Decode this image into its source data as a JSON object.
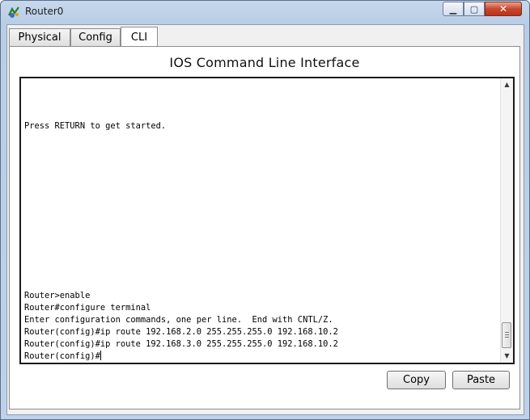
{
  "window": {
    "title": "Router0"
  },
  "tabs": [
    {
      "label": "Physical"
    },
    {
      "label": "Config"
    },
    {
      "label": "CLI"
    }
  ],
  "cli": {
    "heading": "IOS Command Line Interface",
    "lines": [
      "Press RETURN to get started.",
      "Router>enable",
      "Router#configure terminal",
      "Enter configuration commands, one per line.  End with CNTL/Z.",
      "Router(config)#ip route 192.168.2.0 255.255.255.0 192.168.10.2",
      "Router(config)#ip route 192.168.3.0 255.255.255.0 192.168.10.2",
      "Router(config)#"
    ]
  },
  "buttons": {
    "copy": "Copy",
    "paste": "Paste"
  },
  "icons": {
    "app": "router-icon",
    "minimize": "minimize-icon",
    "maximize": "maximize-icon",
    "close": "close-icon"
  }
}
